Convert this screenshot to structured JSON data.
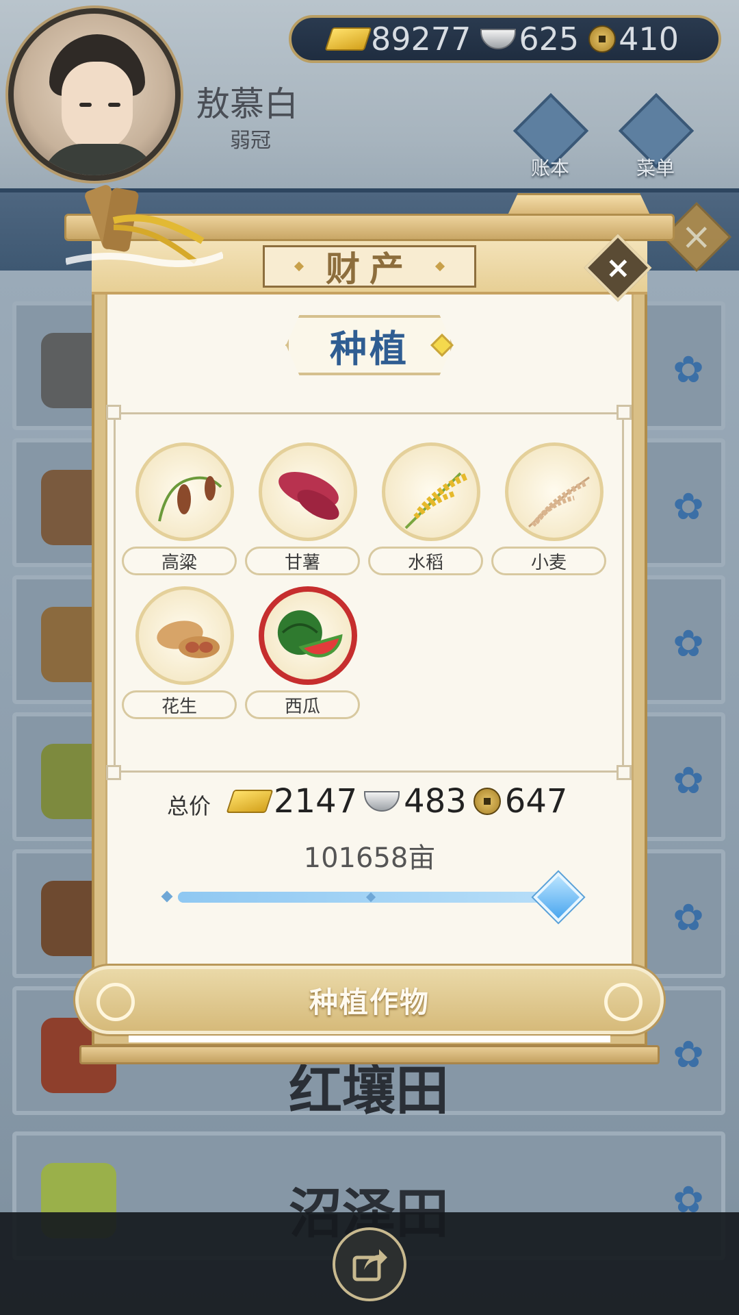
{
  "player": {
    "name": "敖慕白",
    "title": "弱冠"
  },
  "currency": {
    "gold": "89277",
    "silver": "625",
    "coins": "410"
  },
  "top_buttons": {
    "ledger": "账本",
    "menu": "菜单"
  },
  "background_cards": [
    {
      "title": ""
    },
    {
      "title": ""
    },
    {
      "title": ""
    },
    {
      "title": ""
    },
    {
      "title": ""
    },
    {
      "title": "红壤田"
    },
    {
      "title": "沼泽田"
    }
  ],
  "modal": {
    "title": "财产",
    "category": "种植",
    "crops": [
      {
        "name": "高粱",
        "icon": "sorghum-icon",
        "selected": false
      },
      {
        "name": "甘薯",
        "icon": "sweet-potato-icon",
        "selected": false
      },
      {
        "name": "水稻",
        "icon": "rice-icon",
        "selected": false
      },
      {
        "name": "小麦",
        "icon": "wheat-icon",
        "selected": false
      },
      {
        "name": "花生",
        "icon": "peanut-icon",
        "selected": false
      },
      {
        "name": "西瓜",
        "icon": "watermelon-icon",
        "selected": true
      }
    ],
    "total_label": "总价",
    "total": {
      "gold": "2147",
      "silver": "483",
      "coins": "647"
    },
    "area": "101658亩",
    "slider_fraction": 1.0,
    "action_button": "种植作物",
    "close_icon": "×"
  },
  "colors": {
    "accent_blue": "#2f5d92",
    "selected_red": "#c62e2e",
    "gold_frame": "#b08d4c"
  }
}
